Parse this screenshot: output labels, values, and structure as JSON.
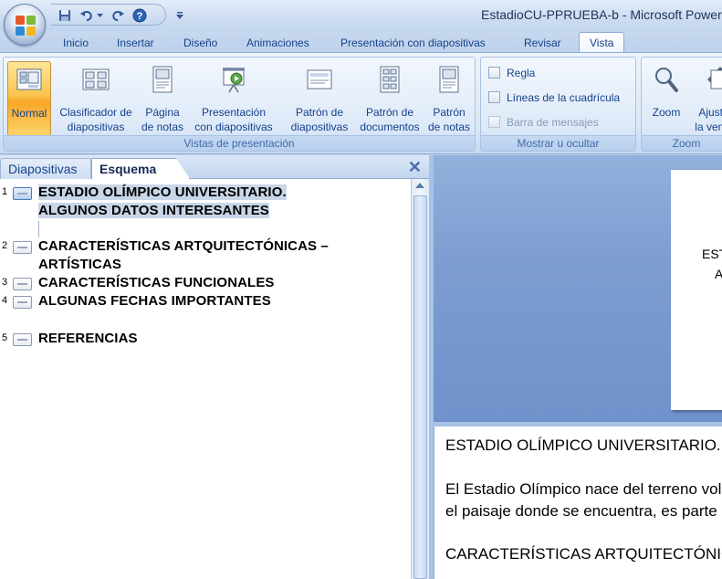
{
  "window": {
    "title": "EstadioCU-PPRUEBA-b - Microsoft PowerPoint"
  },
  "ribbon_tabs": [
    {
      "label": "Inicio"
    },
    {
      "label": "Insertar"
    },
    {
      "label": "Diseño"
    },
    {
      "label": "Animaciones"
    },
    {
      "label": "Presentación con diapositivas"
    },
    {
      "label": "Revisar"
    },
    {
      "label": "Vista",
      "active": true
    }
  ],
  "groups": {
    "views": {
      "label": "Vistas de presentación",
      "buttons": [
        {
          "line1": "Normal",
          "line2": "",
          "icon": "normal-view-icon",
          "active": true
        },
        {
          "line1": "Clasificador de",
          "line2": "diapositivas",
          "icon": "slide-sorter-icon"
        },
        {
          "line1": "Página",
          "line2": "de notas",
          "icon": "notes-page-icon"
        },
        {
          "line1": "Presentación",
          "line2": "con diapositivas",
          "icon": "slideshow-icon"
        },
        {
          "line1": "Patrón de",
          "line2": "diapositivas",
          "icon": "slide-master-icon"
        },
        {
          "line1": "Patrón de",
          "line2": "documentos",
          "icon": "handout-master-icon"
        },
        {
          "line1": "Patrón",
          "line2": "de notas",
          "icon": "notes-master-icon"
        }
      ]
    },
    "show_hide": {
      "label": "Mostrar u ocultar",
      "items": [
        {
          "label": "Regla",
          "checked": false,
          "enabled": true
        },
        {
          "label": "Líneas de la cuadrícula",
          "checked": false,
          "enabled": true
        },
        {
          "label": "Barra de mensajes",
          "checked": false,
          "enabled": false
        }
      ]
    },
    "zoom": {
      "label": "Zoom",
      "buttons": [
        {
          "line1": "Zoom",
          "line2": "",
          "icon": "magnifier-icon"
        },
        {
          "line1": "Ajustar a",
          "line2": "la ventana",
          "icon": "fit-window-icon"
        }
      ]
    }
  },
  "left_pane": {
    "tab_slides": "Diapositivas",
    "tab_outline": "Esquema",
    "close_glyph": "✕",
    "slides": [
      {
        "num": "1",
        "lines": [
          "ESTADIO OLÍMPICO UNIVERSITARIO.",
          "ALGUNOS DATOS INTERESANTES"
        ],
        "selected": true
      },
      {
        "num": "2",
        "lines": [
          "CARACTERÍSTICAS ARTQUITECTÓNICAS –",
          "ARTÍSTICAS"
        ]
      },
      {
        "num": "3",
        "lines": [
          "CARACTERÍSTICAS FUNCIONALES"
        ]
      },
      {
        "num": "4",
        "lines": [
          "ALGUNAS FECHAS IMPORTANTES"
        ]
      },
      {
        "num": "5",
        "lines": [
          "REFERENCIAS"
        ]
      }
    ]
  },
  "slide_preview": {
    "line1": "ESTADIO OLÍMPICO UNIVERSITARIO.",
    "line2": "ALGUNOS DATOS INTERESANTES"
  },
  "notes": {
    "line1": "ESTADIO OLÍMPICO UNIVERSITARIO.",
    "line2": "El Estadio Olímpico nace del terreno volcánico,",
    "line3": "el paisaje donde se encuentra,  es parte de él.",
    "line4": "CARACTERÍSTICAS ARTQUITECTÓNICAS"
  }
}
